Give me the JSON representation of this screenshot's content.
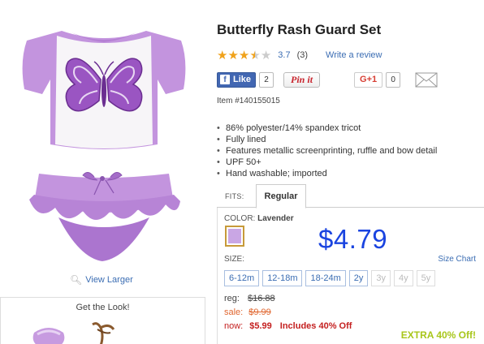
{
  "product": {
    "title": "Butterfly Rash Guard Set",
    "rating_value": "3.7",
    "rating_count": "(3)",
    "rating_stars": 3.7,
    "write_review": "Write a review",
    "item_number": "Item #140155015",
    "view_larger": "View Larger",
    "get_the_look": "Get the Look!"
  },
  "social": {
    "facebook_label": "Like",
    "facebook_count": "2",
    "pinit_label": "Pin it",
    "gplus_label": "G+1",
    "gplus_count": "0",
    "mail_icon": "mail-icon"
  },
  "features": [
    "86% polyester/14% spandex tricot",
    "Fully lined",
    "Features metallic screenprinting, ruffle and bow detail",
    "UPF 50+",
    "Hand washable; imported"
  ],
  "fits": {
    "label": "FITS:",
    "selected_tab": "Regular"
  },
  "color": {
    "label": "COLOR:",
    "value": "Lavender",
    "swatch_color": "#c9a6e4"
  },
  "price": {
    "display": "$4.79",
    "reg_label": "reg:",
    "reg_value": "$16.88",
    "sale_label": "sale:",
    "sale_value": "$9.99",
    "now_label": "now:",
    "now_value": "$5.99",
    "includes": "Includes 40% Off",
    "extra_offer": "EXTRA 40% Off!"
  },
  "size": {
    "label": "SIZE:",
    "chart_link": "Size Chart",
    "options": [
      {
        "label": "6-12m",
        "available": true
      },
      {
        "label": "12-18m",
        "available": true
      },
      {
        "label": "18-24m",
        "available": true
      },
      {
        "label": "2y",
        "available": true
      },
      {
        "label": "3y",
        "available": false
      },
      {
        "label": "4y",
        "available": false
      },
      {
        "label": "5y",
        "available": false
      }
    ]
  },
  "colors": {
    "link": "#3b6db3",
    "price_blue": "#1a44e0",
    "sale_orange": "#e0662f",
    "now_red": "#c42020",
    "extra_green": "#a8c61b",
    "star": "#f0a21b",
    "lavender": "#b98ad6"
  }
}
